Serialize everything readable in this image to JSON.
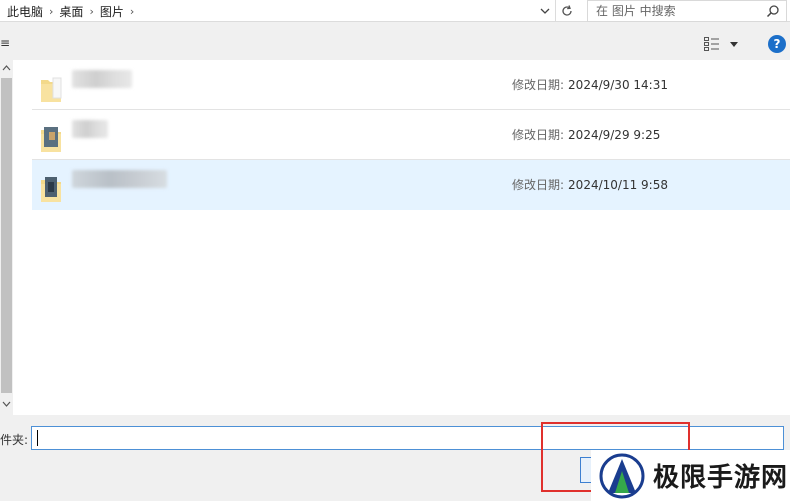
{
  "address_bar": {
    "breadcrumbs": [
      "此电脑",
      "桌面",
      "图片"
    ],
    "search_placeholder": "在 图片 中搜索"
  },
  "toolbar": {
    "edge_text": "≡",
    "help_label": "?"
  },
  "files": [
    {
      "modified_label": "修改日期:",
      "modified_value": "2024/9/30 14:31",
      "selected": false
    },
    {
      "modified_label": "修改日期:",
      "modified_value": "2024/9/29 9:25",
      "selected": false
    },
    {
      "modified_label": "修改日期:",
      "modified_value": "2024/10/11 9:58",
      "selected": true
    }
  ],
  "bottom": {
    "folder_label": "件夹:",
    "folder_value": ""
  },
  "watermark": {
    "text": "极限手游网"
  },
  "colors": {
    "selection_bg": "#e5f3ff",
    "highlight_red": "#e0302d",
    "accent_blue": "#1c6fc9"
  }
}
